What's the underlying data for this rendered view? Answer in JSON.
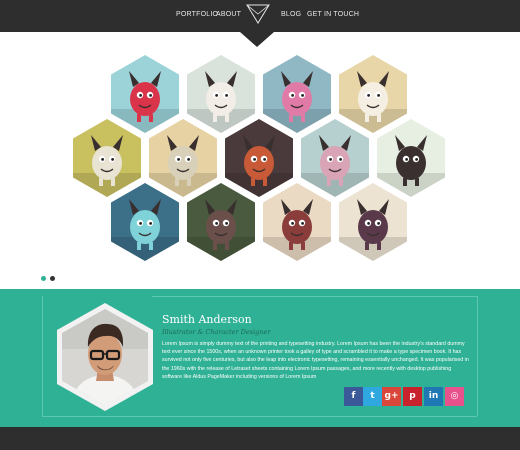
{
  "nav": {
    "items": [
      {
        "label": "PORTFOLIO"
      },
      {
        "label": "ABOUT"
      },
      {
        "label": "BLOG"
      },
      {
        "label": "GET IN TOUCH"
      }
    ]
  },
  "gallery": {
    "images": [
      {
        "icon": "red-monster-illustration",
        "bg": "#9bd3d9",
        "fg": "#d9344a"
      },
      {
        "icon": "white-monster-illustration",
        "bg": "#d9e3dc",
        "fg": "#f2ede6"
      },
      {
        "icon": "pink-yellow-monster-illustration",
        "bg": "#8fb8c4",
        "fg": "#e07ba8"
      },
      {
        "icon": "white-bird-monster-illustration",
        "bg": "#e9d6a8",
        "fg": "#f4efe2"
      },
      {
        "icon": "lizard-monster-illustration",
        "bg": "#c9c060",
        "fg": "#e8e3d2"
      },
      {
        "icon": "deer-monster-illustration",
        "bg": "#e6d2a2",
        "fg": "#d8d0b9"
      },
      {
        "icon": "mushroom-monster-illustration",
        "bg": "#4a3a3c",
        "fg": "#c85a38"
      },
      {
        "icon": "twin-monsters-illustration",
        "bg": "#b6d0cf",
        "fg": "#d9a5b6"
      },
      {
        "icon": "hooded-monster-illustration",
        "bg": "#e7efe2",
        "fg": "#3a3030"
      },
      {
        "icon": "jellyfish-illustration",
        "bg": "#3c6f88",
        "fg": "#7fd3d8"
      },
      {
        "icon": "spiky-monster-illustration",
        "bg": "#4a5a3e",
        "fg": "#6a4f4a"
      },
      {
        "icon": "flying-creature-illustration",
        "bg": "#ead9c3",
        "fg": "#8a3d3a"
      },
      {
        "icon": "horned-island-illustration",
        "bg": "#ece3d2",
        "fg": "#5a3a4a"
      }
    ],
    "slider_active": 0
  },
  "profile": {
    "name": "Smith Anderson",
    "role": "Illustrator & Character Designer",
    "bio": "Lorem Ipsum is simply dummy text of the printing and typesetting industry. Lorem Ipsum has been the industry's standard dummy text ever since the 1500s, when an unknown printer took a galley of type and scrambled it to make a type specimen book. It has survived not only five centuries, but also the leap into electronic typesetting, remaining essentially unchanged. It was popularised in the 1960s with the release of Letraset sheets containing Lorem Ipsum passages, and more recently with desktop publishing software like Aldus PageMaker including versions of Lorem Ipsum",
    "social": [
      {
        "icon": "facebook-icon",
        "glyph": "f",
        "color": "#3b5998"
      },
      {
        "icon": "twitter-icon",
        "glyph": "t",
        "color": "#2fa8e0"
      },
      {
        "icon": "google-plus-icon",
        "glyph": "g+",
        "color": "#d9473b"
      },
      {
        "icon": "pinterest-icon",
        "glyph": "p",
        "color": "#c8232c"
      },
      {
        "icon": "linkedin-icon",
        "glyph": "in",
        "color": "#1f78b4"
      },
      {
        "icon": "dribbble-icon",
        "glyph": "◎",
        "color": "#e8528c"
      }
    ]
  },
  "colors": {
    "nav_bg": "#2e2e2e",
    "accent": "#2fb195",
    "dot_active": "#2fb195",
    "dot_inactive": "#333333"
  }
}
